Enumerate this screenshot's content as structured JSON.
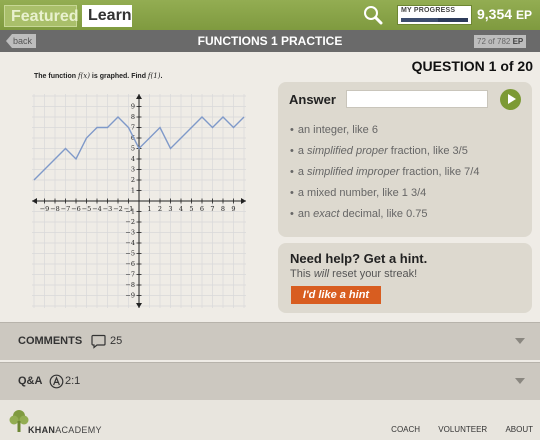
{
  "topbar": {
    "tabs": [
      "Featured",
      "Learn"
    ],
    "progress_label": "MY PROGRESS",
    "progress_fraction": 0.55,
    "ep_value": "9,354",
    "ep_unit": "EP"
  },
  "header": {
    "back_label": "back",
    "title": "FUNCTIONS 1 PRACTICE",
    "counter_current": "72",
    "counter_of": " of 782 ",
    "counter_unit": "EP"
  },
  "question": {
    "title": "QUESTION 1 of 20",
    "text_prefix": "The function ",
    "func": "f(x)",
    "text_middle": " is graphed. Find ",
    "target": "f(1)",
    "text_suffix": "."
  },
  "graph": {
    "x_ticks": [
      "−9",
      "−8",
      "−7",
      "−6",
      "−5",
      "−4",
      "−3",
      "−2",
      "−1",
      "1",
      "2",
      "3",
      "4",
      "5",
      "6",
      "7",
      "8",
      "9"
    ],
    "y_ticks": [
      "9",
      "8",
      "7",
      "6",
      "5",
      "4",
      "3",
      "2",
      "1",
      "−1",
      "−2",
      "−3",
      "−4",
      "−5",
      "−6",
      "−7",
      "−8",
      "−9"
    ],
    "points": [
      [
        -10,
        2
      ],
      [
        -9,
        3
      ],
      [
        -8,
        4
      ],
      [
        -7,
        5
      ],
      [
        -6,
        4
      ],
      [
        -5,
        6
      ],
      [
        -4,
        7
      ],
      [
        -3,
        7
      ],
      [
        -2,
        8
      ],
      [
        -1,
        7
      ],
      [
        0,
        5
      ],
      [
        1,
        6
      ],
      [
        2,
        7
      ],
      [
        3,
        5
      ],
      [
        4,
        6
      ],
      [
        5,
        7
      ],
      [
        6,
        8
      ],
      [
        7,
        7
      ],
      [
        8,
        8
      ],
      [
        9,
        7
      ],
      [
        10,
        8
      ]
    ],
    "line_color": "#7f99c9"
  },
  "answer": {
    "label": "Answer",
    "hints": [
      [
        "an integer, like 6"
      ],
      [
        "a ",
        "simplified proper",
        " fraction, like 3/5"
      ],
      [
        "a ",
        "simplified improper",
        " fraction, like 7/4"
      ],
      [
        "a mixed number, like 1 3/4"
      ],
      [
        "an ",
        "exact",
        " decimal, like 0.75"
      ]
    ]
  },
  "hint_box": {
    "title": "Need help? Get a hint.",
    "warning_pre": "This ",
    "warning_em": "will",
    "warning_post": " reset your streak!",
    "button": "I'd like a hint"
  },
  "comments": {
    "label": "COMMENTS",
    "count": "25"
  },
  "qa": {
    "label": "Q&A",
    "count": "2:1"
  },
  "footer": {
    "logo_strong": "KHAN",
    "logo_rest": "ACADEMY",
    "links": [
      "COACH",
      "VOLUNTEER",
      "ABOUT"
    ]
  },
  "colors": {
    "accent_green": "#7f9a3f",
    "hint_orange": "#d85d20",
    "submit_green": "#7c9a34"
  }
}
